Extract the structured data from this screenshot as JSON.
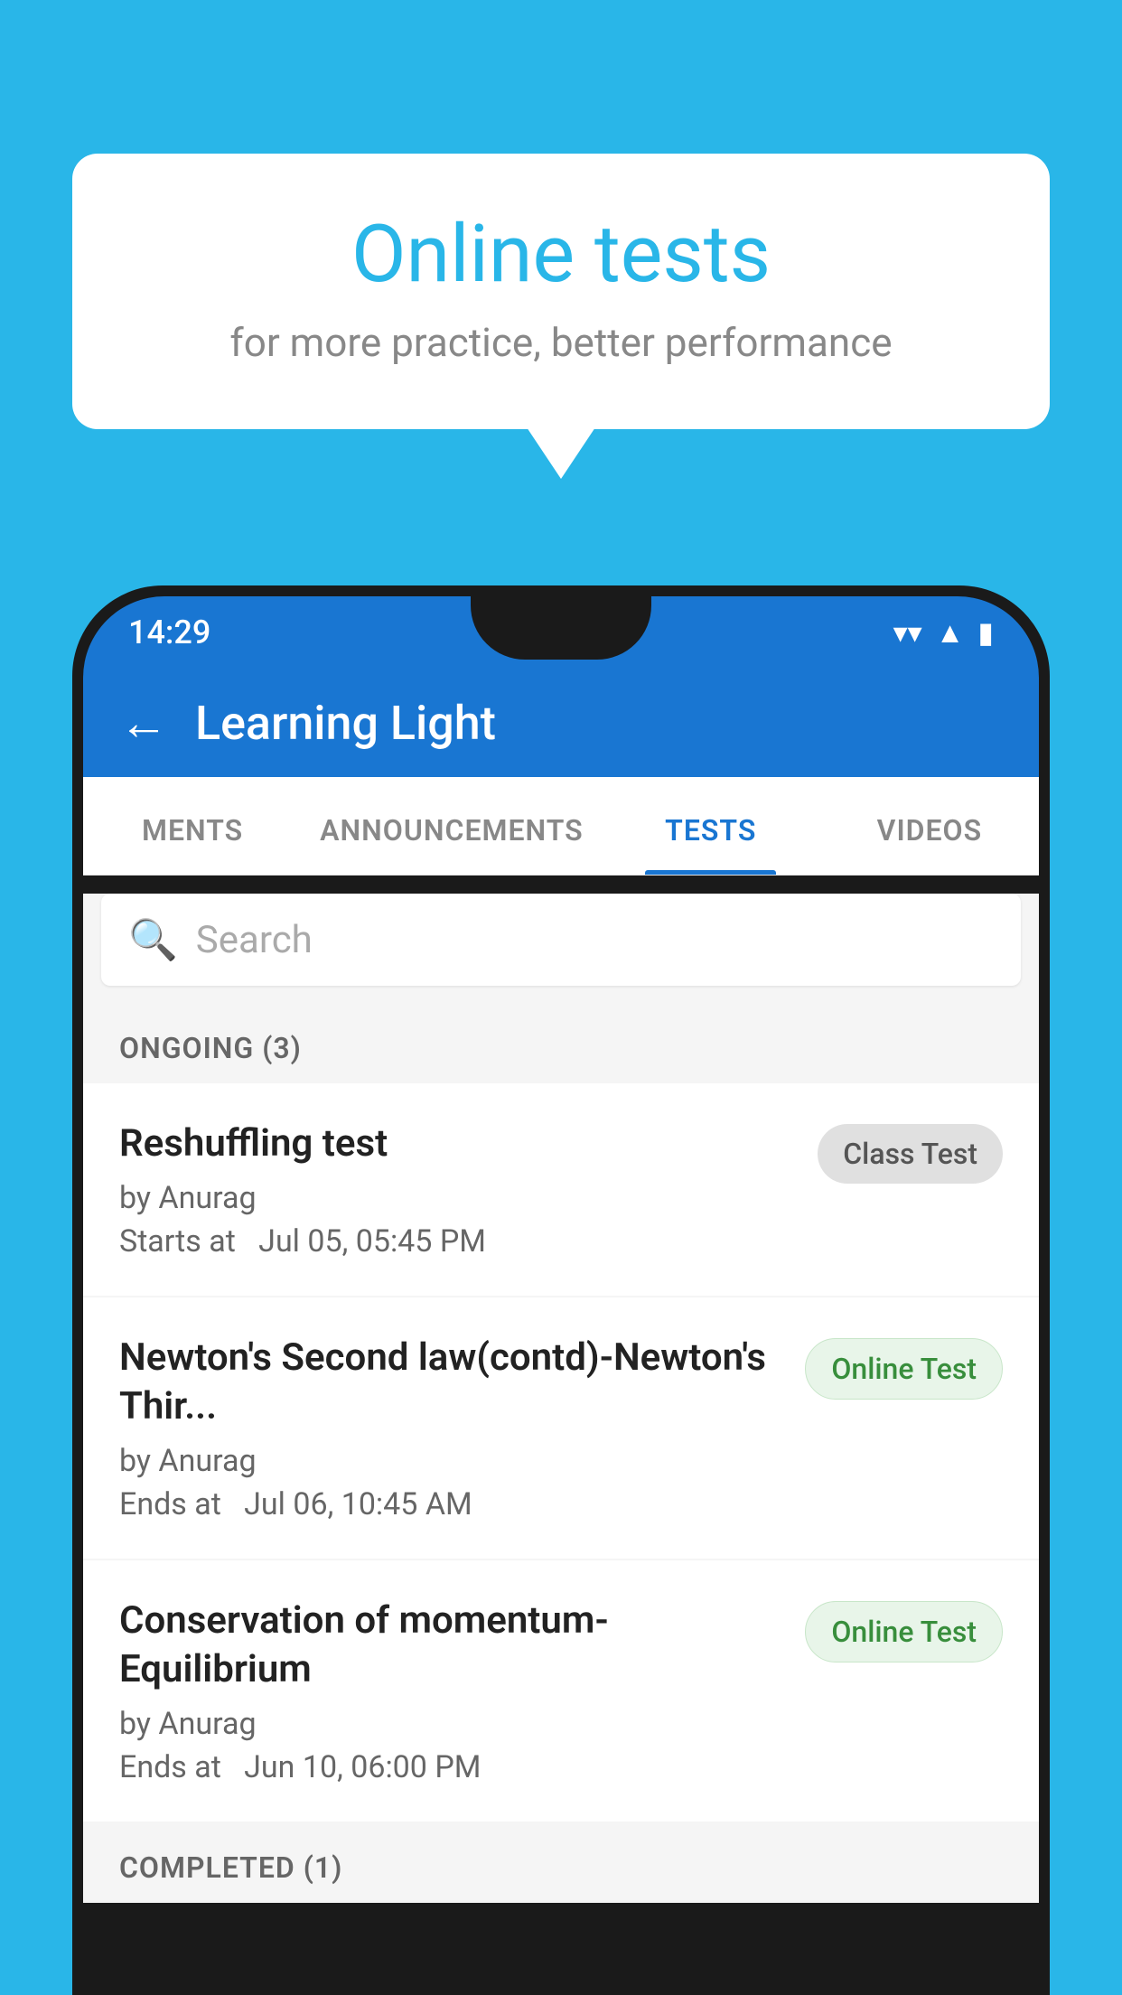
{
  "background_color": "#29b6e8",
  "bubble": {
    "title": "Online tests",
    "subtitle": "for more practice, better performance"
  },
  "status_bar": {
    "time": "14:29",
    "wifi": "▼",
    "signal": "▲",
    "battery": "▮"
  },
  "app_bar": {
    "back_label": "←",
    "title": "Learning Light"
  },
  "tabs": [
    {
      "id": "ments",
      "label": "MENTS",
      "active": false
    },
    {
      "id": "announcements",
      "label": "ANNOUNCEMENTS",
      "active": false
    },
    {
      "id": "tests",
      "label": "TESTS",
      "active": true
    },
    {
      "id": "videos",
      "label": "VIDEOS",
      "active": false
    }
  ],
  "search": {
    "placeholder": "Search",
    "icon": "🔍"
  },
  "ongoing_section": {
    "header": "ONGOING (3)",
    "items": [
      {
        "id": "reshuffling",
        "name": "Reshuffling test",
        "author": "by Anurag",
        "time_label": "Starts at",
        "time": "Jul 05, 05:45 PM",
        "badge": "Class Test",
        "badge_type": "class"
      },
      {
        "id": "newtons",
        "name": "Newton's Second law(contd)-Newton's Thir...",
        "author": "by Anurag",
        "time_label": "Ends at",
        "time": "Jul 06, 10:45 AM",
        "badge": "Online Test",
        "badge_type": "online"
      },
      {
        "id": "conservation",
        "name": "Conservation of momentum-Equilibrium",
        "author": "by Anurag",
        "time_label": "Ends at",
        "time": "Jun 10, 06:00 PM",
        "badge": "Online Test",
        "badge_type": "online"
      }
    ]
  },
  "completed_section": {
    "header": "COMPLETED (1)"
  }
}
